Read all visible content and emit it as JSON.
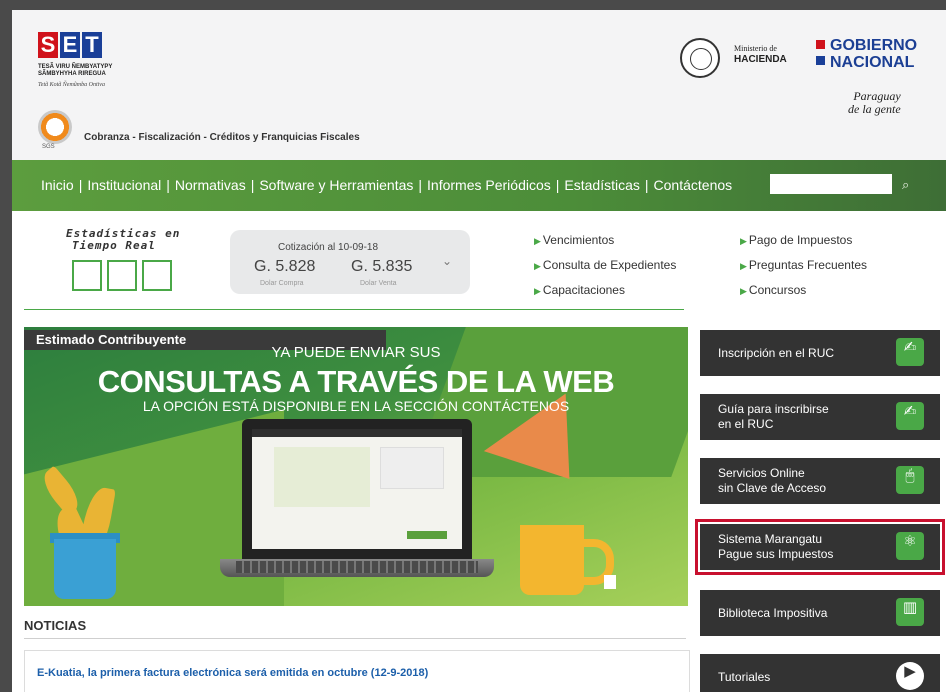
{
  "header": {
    "logo_letters": [
      "S",
      "E",
      "T"
    ],
    "logo_colors": [
      "#d0121b",
      "#1a3f98",
      "#1a3f98"
    ],
    "logo_tagline": "TESÃ VIRU ÑEMBYATYPY SÃMBYHYHA RIREGUA",
    "logo_subtagline": "Tetã Kotã Ñemũmba Ontiva",
    "sgs_label": "SGS",
    "program_text": "Cobranza - Fiscalización - Créditos y Franquicias Fiscales",
    "ministerio_label": "Ministerio de",
    "hacienda_label": "HACIENDA",
    "gobierno_line1": "GOBIERNO",
    "gobierno_line2": "NACIONAL",
    "paraguay_line1": "Paraguay",
    "paraguay_line2": "de la gente",
    "gobierno_marks_colors": [
      "#d0121b",
      "#1a3f98"
    ]
  },
  "nav": {
    "items": [
      {
        "label": "Inicio"
      },
      {
        "label": "Institucional"
      },
      {
        "label": "Normativas"
      },
      {
        "label": "Software y Herramientas"
      },
      {
        "label": "Informes Periódicos"
      },
      {
        "label": "Estadísticas"
      },
      {
        "label": "Contáctenos"
      }
    ],
    "search_placeholder": "",
    "search_icon": "search-icon"
  },
  "stats": {
    "title_line1": "Estadísticas en",
    "title_line2": "Tiempo Real"
  },
  "cotizacion": {
    "title": "Cotización al 10-09-18",
    "compra_value": "G. 5.828",
    "venta_value": "G. 5.835",
    "compra_label": "Dolar Compra",
    "venta_label": "Dolar Venta",
    "expand_icon": "chevron-down-icon"
  },
  "quick_links": {
    "col1": [
      {
        "label": "Vencimientos"
      },
      {
        "label": "Consulta de Expedientes"
      },
      {
        "label": "Capacitaciones"
      }
    ],
    "col2": [
      {
        "label": "Pago de Impuestos"
      },
      {
        "label": "Preguntas Frecuentes"
      },
      {
        "label": "Concursos"
      }
    ]
  },
  "banner": {
    "tag": "Estimado Contribuyente",
    "line1": "YA PUEDE ENVIAR SUS",
    "line2": "CONSULTAS A TRAVÉS DE LA WEB",
    "line3": "LA OPCIÓN ESTÁ DISPONIBLE EN LA SECCIÓN CONTÁCTENOS"
  },
  "noticias": {
    "title": "NOTICIAS",
    "items": [
      {
        "title": "E-Kuatia, la primera factura electrónica será emitida en octubre (12-9-2018)"
      }
    ]
  },
  "side_buttons": [
    {
      "line1": "Inscripción en el RUC",
      "line2": "",
      "icon": "signature-icon",
      "highlighted": false
    },
    {
      "line1": "Guía para inscribirse",
      "line2": "en el RUC",
      "icon": "signature-icon",
      "highlighted": false
    },
    {
      "line1": "Servicios Online",
      "line2": "sin Clave de Acceso",
      "icon": "mouse-icon",
      "highlighted": false
    },
    {
      "line1": "Sistema Marangatu",
      "line2": "Pague sus Impuestos",
      "icon": "atom-icon",
      "highlighted": true
    },
    {
      "line1": "Biblioteca Impositiva",
      "line2": "",
      "icon": "books-icon",
      "highlighted": false
    },
    {
      "line1": "Tutoriales",
      "line2": "",
      "icon": "play-icon",
      "highlighted": false
    }
  ],
  "colors": {
    "accent_green": "#4aa847",
    "nav_green": "#4c8d39",
    "dark_button": "#333333",
    "highlight_red": "#c8102e",
    "news_link_blue": "#1c5faa"
  }
}
